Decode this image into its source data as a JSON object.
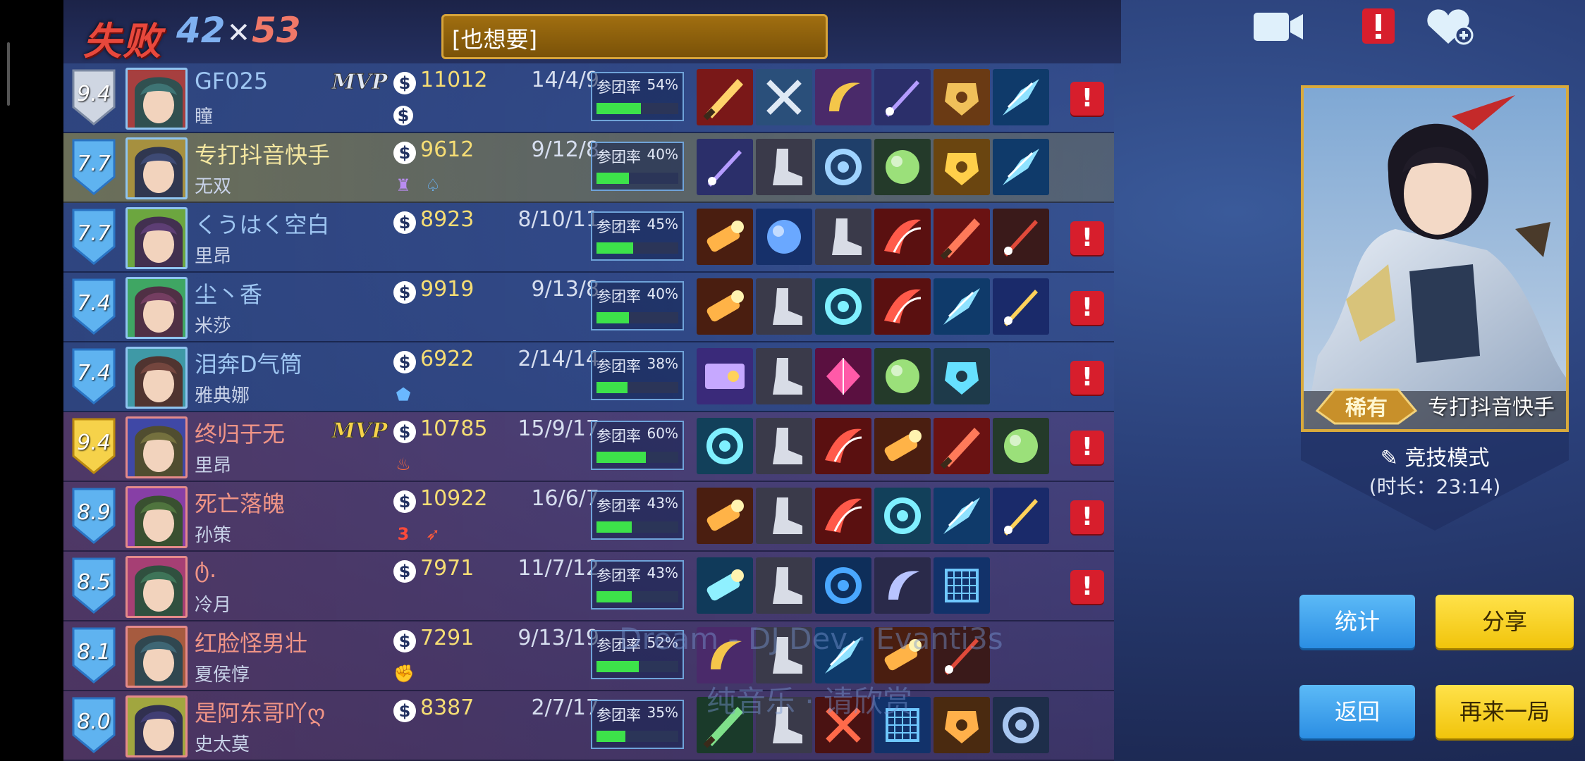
{
  "header": {
    "result": "失败",
    "score_blue": "42",
    "score_red": "53",
    "chat_message": "[也想要]"
  },
  "players": [
    {
      "team": "blue",
      "rating": "9.4",
      "badge": "silver",
      "mvp": true,
      "name": "GF025",
      "hero": "瞳",
      "gold": "11012",
      "kda": "14/4/9",
      "participation": "54%",
      "part_value": 54,
      "extras": [
        "coin-icon"
      ],
      "items": [
        "blade-item",
        "axe-item",
        "scythe-item",
        "crystal-sword-item",
        "armor-item",
        "ice-shard-item"
      ],
      "report": true
    },
    {
      "team": "me",
      "rating": "7.7",
      "badge": "blue",
      "mvp": false,
      "name": "专打抖音快手",
      "hero": "无双",
      "gold": "9612",
      "kda": "9/12/8",
      "participation": "40%",
      "part_value": 40,
      "extras": [
        "tower-icon",
        "jungle-icon"
      ],
      "items": [
        "crystal-sword-item",
        "boots-item",
        "compass-item",
        "spiked-orb-item",
        "gold-armor-item",
        "ice-shard-item"
      ],
      "report": false
    },
    {
      "team": "blue",
      "rating": "7.7",
      "badge": "blue",
      "mvp": false,
      "name": "くうはく空白",
      "hero": "里昂",
      "gold": "8923",
      "kda": "8/10/11",
      "participation": "45%",
      "part_value": 45,
      "extras": [],
      "items": [
        "cannon-item",
        "blue-orb-item",
        "boots-item",
        "claw-item",
        "red-blade-item",
        "dark-sword-item"
      ],
      "report": true
    },
    {
      "team": "blue",
      "rating": "7.4",
      "badge": "blue",
      "mvp": false,
      "name": "尘丶香",
      "hero": "米莎",
      "gold": "9919",
      "kda": "9/13/8",
      "participation": "40%",
      "part_value": 40,
      "extras": [],
      "items": [
        "cannon-item",
        "boots-item",
        "hammer-item",
        "claw-item",
        "ice-shard-item",
        "golden-spear-item"
      ],
      "report": true
    },
    {
      "team": "blue",
      "rating": "7.4",
      "badge": "blue",
      "mvp": false,
      "name": "泪奔D气筒",
      "hero": "雅典娜",
      "gold": "6922",
      "kda": "2/14/14",
      "participation": "38%",
      "part_value": 38,
      "extras": [
        "shield-icon"
      ],
      "items": [
        "ticket-item",
        "boots-item",
        "pink-gem-item",
        "spiked-orb-item",
        "gauntlet-item",
        "empty"
      ],
      "report": true
    },
    {
      "team": "red",
      "rating": "9.4",
      "badge": "gold",
      "mvp": true,
      "name": "终归于无",
      "hero": "里昂",
      "gold": "10785",
      "kda": "15/9/17",
      "participation": "60%",
      "part_value": 60,
      "extras": [
        "fire-icon"
      ],
      "items": [
        "hammer-item",
        "boots-item",
        "claw-item",
        "cannon-item",
        "red-blade-item",
        "spiked-orb-item"
      ],
      "report": true
    },
    {
      "team": "red",
      "rating": "8.9",
      "badge": "blue",
      "mvp": false,
      "name": "死亡落魄",
      "hero": "孙策",
      "gold": "10922",
      "kda": "16/6/7",
      "participation": "43%",
      "part_value": 43,
      "extras": [
        "triple-icon",
        "sword-icon"
      ],
      "items": [
        "cannon-item",
        "boots-item",
        "claw-item",
        "hammer-item",
        "ice-shard-item",
        "golden-spear-item"
      ],
      "report": true
    },
    {
      "team": "red",
      "rating": "8.5",
      "badge": "blue",
      "mvp": false,
      "name": "ტ.",
      "hero": "冷月",
      "gold": "7971",
      "kda": "11/7/12",
      "participation": "43%",
      "part_value": 43,
      "extras": [],
      "items": [
        "ice-cannon-item",
        "boots-item",
        "blue-ring-item",
        "bow-item",
        "cube-item",
        "empty"
      ],
      "report": true
    },
    {
      "team": "red",
      "rating": "8.1",
      "badge": "blue",
      "mvp": false,
      "name": "红脸怪男壮",
      "hero": "夏侯惇",
      "gold": "7291",
      "kda": "9/13/19",
      "participation": "52%",
      "part_value": 52,
      "extras": [
        "fist-icon"
      ],
      "items": [
        "scythe-item",
        "boots-item",
        "ice-shard-item",
        "cannon-item",
        "dark-sword-item",
        "empty"
      ],
      "report": false
    },
    {
      "team": "red",
      "rating": "8.0",
      "badge": "blue",
      "mvp": false,
      "name": "是阿东哥吖ღ",
      "hero": "史太莫",
      "gold": "8387",
      "kda": "2/7/17",
      "participation": "35%",
      "part_value": 35,
      "extras": [],
      "items": [
        "saw-item",
        "boots-item",
        "crossbow-item",
        "cube-item",
        "lantern-item",
        "clock-item"
      ],
      "report": false
    }
  ],
  "watermark": {
    "line1": "Dream - DJ Dev · Evanti3s",
    "line2": "纯音乐 · 请欣赏"
  },
  "featured": {
    "player_name": "专打抖音快手",
    "rarity": "稀有",
    "mode": "竞技模式",
    "duration": "(时长：23:14)"
  },
  "buttons": {
    "stats": "统计",
    "share": "分享",
    "back": "返回",
    "again": "再来一局"
  },
  "labels": {
    "participation": "参团率",
    "mvp": "MVP",
    "coin": "$",
    "report": "!"
  },
  "colors": {
    "lose_red": "#e8483c",
    "blue_team": "#9ec6f2",
    "red_team": "#f09486",
    "gold_text": "#f6dd74",
    "participation_bar": "#3de24a",
    "report_red": "#d71e2c",
    "button_blue": "#2b8ee3",
    "button_yellow": "#f1c40b"
  }
}
